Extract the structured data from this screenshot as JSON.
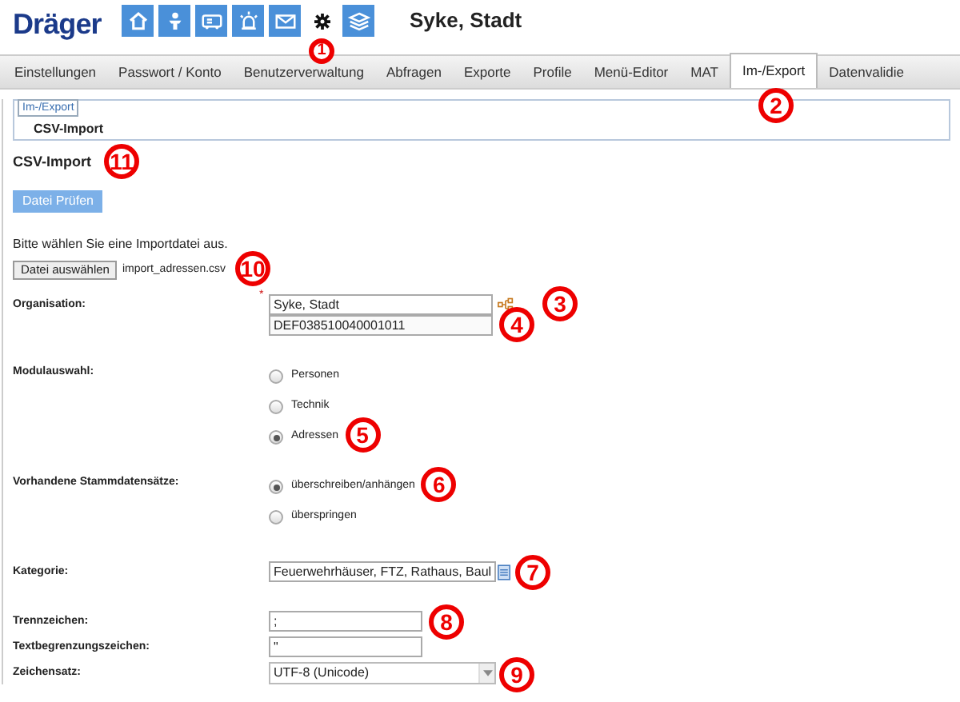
{
  "header": {
    "logo": "Dräger",
    "title": "Syke, Stadt",
    "nav_icons": [
      {
        "kind": "home",
        "selected": false
      },
      {
        "kind": "person",
        "selected": false
      },
      {
        "kind": "truck",
        "selected": false
      },
      {
        "kind": "alarm",
        "selected": false
      },
      {
        "kind": "mail",
        "selected": false
      },
      {
        "kind": "gear",
        "selected": true,
        "callout": "1"
      },
      {
        "kind": "layers",
        "selected": false
      }
    ]
  },
  "tabs": [
    {
      "label": "Einstellungen",
      "selected": false
    },
    {
      "label": "Passwort / Konto",
      "selected": false
    },
    {
      "label": "Benutzerverwaltung",
      "selected": false
    },
    {
      "label": "Abfragen",
      "selected": false
    },
    {
      "label": "Exporte",
      "selected": false
    },
    {
      "label": "Profile",
      "selected": false
    },
    {
      "label": "Menü-Editor",
      "selected": false
    },
    {
      "label": "MAT",
      "selected": false
    },
    {
      "label": "Im-/Export",
      "selected": true,
      "callout": "2"
    },
    {
      "label": "Datenvalidie",
      "selected": false
    }
  ],
  "breadcrumb": {
    "section": "Im-/Export",
    "page": "CSV-Import"
  },
  "heading": {
    "text": "CSV-Import",
    "callout": "11"
  },
  "check_button": "Datei Prüfen",
  "instruction": "Bitte wählen Sie eine Importdatei aus.",
  "file": {
    "button": "Datei auswählen",
    "filename": "import_adressen.csv",
    "callout": "10"
  },
  "organisation": {
    "label": "Organisation:",
    "required_mark": "*",
    "value": "Syke, Stadt",
    "value_callout": "3",
    "code": "DEF038510040001011",
    "code_callout": "4"
  },
  "module": {
    "label": "Modulauswahl:",
    "options": [
      {
        "label": "Personen",
        "selected": false
      },
      {
        "label": "Technik",
        "selected": false
      },
      {
        "label": "Adressen",
        "selected": true,
        "callout": "5"
      }
    ]
  },
  "existing": {
    "label": "Vorhandene Stammdatensätze:",
    "options": [
      {
        "label": "überschreiben/anhängen",
        "selected": true,
        "callout": "6"
      },
      {
        "label": "überspringen",
        "selected": false
      }
    ]
  },
  "category": {
    "label": "Kategorie:",
    "value": "Feuerwehrhäuser, FTZ, Rathaus, Baul",
    "callout": "7"
  },
  "separator": {
    "label": "Trennzeichen:",
    "value": ";",
    "callout": "8"
  },
  "text_delimiter": {
    "label": "Textbegrenzungszeichen:",
    "value": "\""
  },
  "charset": {
    "label": "Zeichensatz:",
    "value": "UTF-8 (Unicode)",
    "callout": "9"
  }
}
